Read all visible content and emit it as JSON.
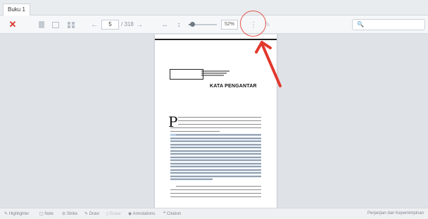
{
  "tab": {
    "title": "Buku 1"
  },
  "toolbar": {
    "close_glyph": "✕",
    "icons": [
      "page-icon",
      "two-page-icon",
      "grid-icon",
      "prev-arrow-icon",
      "next-arrow-icon",
      "fit-width-icon",
      "fit-height-icon",
      "more-icon",
      "pen-icon"
    ],
    "prev_glyph": "←",
    "next_glyph": "→",
    "page_current": "5",
    "page_total": "/ 318",
    "fit_width_glyph": "↔",
    "fit_height_glyph": "↕",
    "zoom_fraction": 0.18,
    "zoom_label": "52%",
    "more_glyph": "⋮",
    "pen_glyph": "✎",
    "search_glyph": "🔍"
  },
  "document": {
    "heading": "KATA PENGANTAR",
    "dropcap": "P"
  },
  "bottom_bar": {
    "highlighter": "Highlighter",
    "note": "Note",
    "strike": "Strike",
    "draw": "Draw",
    "erase": "Erase",
    "annotations": "Annotations",
    "citation": "Citation",
    "right_text": "Perjanjian dan Kepemimpinan"
  },
  "colors": {
    "accent_close": "#d9342b",
    "annotation": "#e2574c",
    "highlight": "#b9cde4"
  }
}
